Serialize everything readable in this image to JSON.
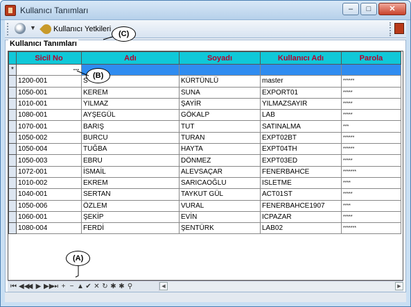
{
  "window": {
    "title": "Kullanıcı Tanımları"
  },
  "toolbar": {
    "user_permissions_label": "Kullanıcı Yetkileri"
  },
  "group": {
    "title": "Kullanıcı Tanımları"
  },
  "grid": {
    "columns": [
      "Sicil No",
      "Adı",
      "Soyadı",
      "Kullanıcı Adı",
      "Parola"
    ],
    "new_row_marker": "*",
    "new_row_button": "...",
    "rows": [
      [
        "1200-001",
        "S",
        "KÜRTÜNLÜ",
        "master",
        "******"
      ],
      [
        "1050-001",
        "KEREM",
        "SUNA",
        "EXPORT01",
        "*****"
      ],
      [
        "1010-001",
        "YILMAZ",
        "ŞAYİR",
        "YILMAZSAYIR",
        "*****"
      ],
      [
        "1080-001",
        "AYŞEGÜL",
        "GÖKALP",
        "LAB",
        "*****"
      ],
      [
        "1070-001",
        "BARIŞ",
        "TUT",
        "SATINALMA",
        "***"
      ],
      [
        "1050-002",
        "BURCU",
        "TURAN",
        "EXPT02BT",
        "******"
      ],
      [
        "1050-004",
        "TUĞBA",
        "HAYTA",
        "EXPT04TH",
        "******"
      ],
      [
        "1050-003",
        "EBRU",
        "DÖNMEZ",
        "EXPT03ED",
        "*****"
      ],
      [
        "1072-001",
        "İSMAİL",
        "ALEVSAÇAR",
        "FENERBAHCE",
        "*******"
      ],
      [
        "1010-002",
        "EKREM",
        "SARICAOĞLU",
        "ISLETME",
        "****"
      ],
      [
        "1040-001",
        "SERTAN",
        "TAYKUT GÜL",
        "ACT01ST",
        "*****"
      ],
      [
        "1050-006",
        "ÖZLEM",
        "VURAL",
        "FENERBAHCE1907",
        "****"
      ],
      [
        "1060-001",
        "ŞEKİP",
        "EVİN",
        "ICPAZAR",
        "*****"
      ],
      [
        "1080-004",
        "FERDİ",
        "ŞENTÜRK",
        "LAB02",
        "*******"
      ]
    ]
  },
  "navigator": {
    "buttons": [
      "⏮",
      "◀◀",
      "◀",
      "▶",
      "▶▶",
      "⏭",
      "+",
      "−",
      "▲",
      "✔",
      "✕",
      "↻",
      "✱",
      "✱",
      "⚲"
    ]
  },
  "callouts": {
    "a": "(A)",
    "b": "(B)",
    "c": "(C)"
  }
}
